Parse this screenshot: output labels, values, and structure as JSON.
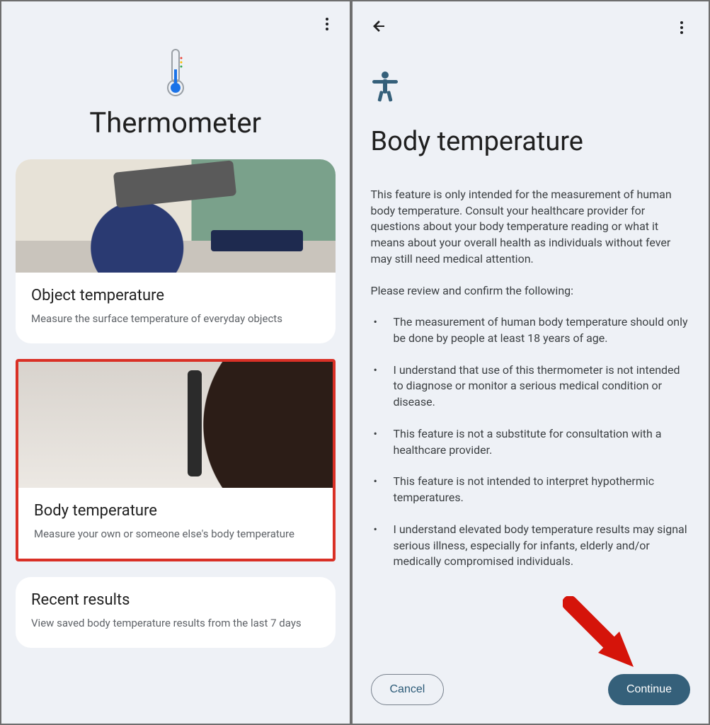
{
  "left": {
    "title": "Thermometer",
    "cards": [
      {
        "title": "Object temperature",
        "subtitle": "Measure the surface temperature of everyday objects"
      },
      {
        "title": "Body temperature",
        "subtitle": "Measure your own or someone else's body temperature"
      },
      {
        "title": "Recent results",
        "subtitle": "View saved body temperature results from the last 7 days"
      }
    ]
  },
  "right": {
    "title": "Body temperature",
    "intro": "This feature is only intended for the measurement of human body temperature. Consult your healthcare provider for questions about your body temperature reading or what it means about your overall health as individuals without fever may still need medical attention.",
    "review_prompt": "Please review and confirm the following:",
    "bullets": [
      "The measurement of human body temperature should only be done by people at least 18 years of age.",
      "I understand that use of this thermometer is not intended to diagnose or monitor a serious medical condition or disease.",
      "This feature is not a substitute for consultation with a healthcare provider.",
      "This feature is not intended to interpret hypothermic temperatures.",
      "I understand elevated body temperature results may signal serious illness, especially for infants, elderly and/or medically compromised individuals."
    ],
    "buttons": {
      "cancel": "Cancel",
      "continue": "Continue"
    }
  },
  "colors": {
    "accent": "#35607a",
    "highlight_border": "#d93026"
  }
}
